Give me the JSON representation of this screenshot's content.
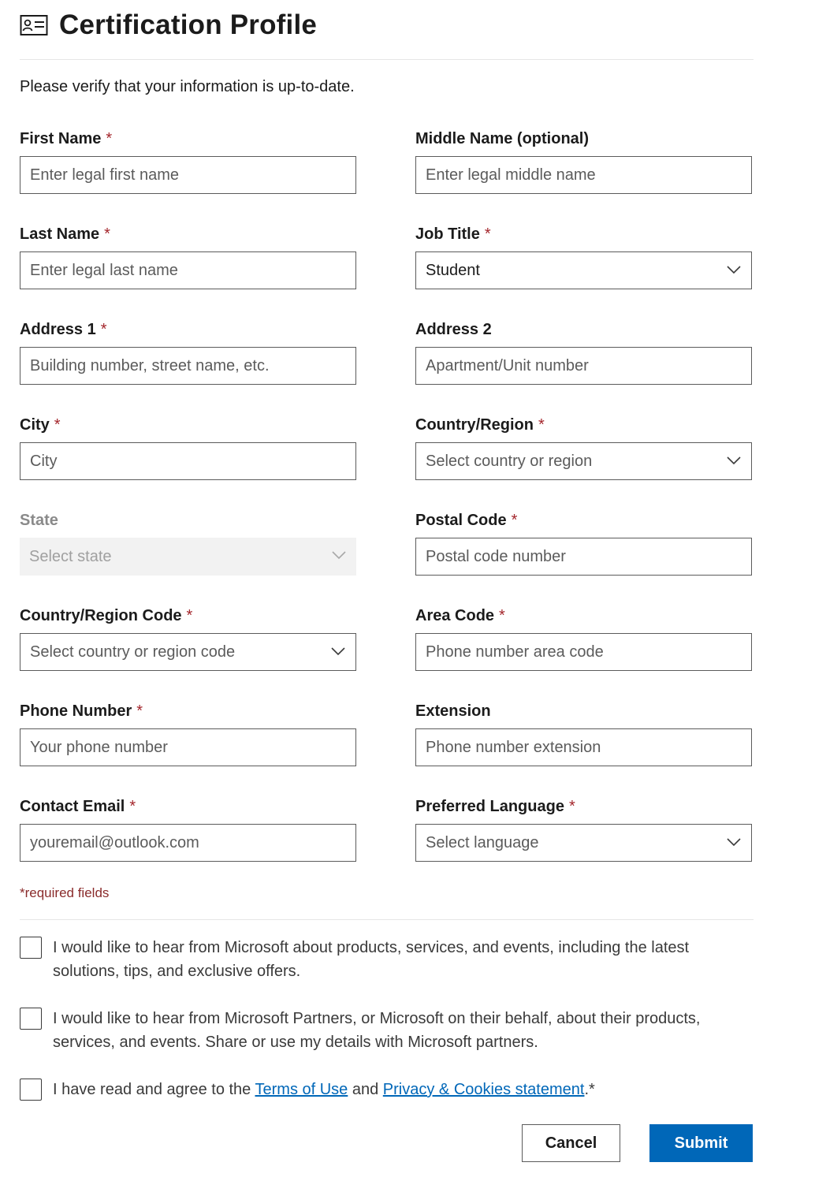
{
  "header": {
    "title": "Certification Profile",
    "icon": "contact-card-icon"
  },
  "intro": "Please verify that your information is up-to-date.",
  "required_marker": "*",
  "fields": {
    "first_name": {
      "label": "First Name",
      "placeholder": "Enter legal first name",
      "required": true
    },
    "middle_name": {
      "label": "Middle Name (optional)",
      "placeholder": "Enter legal middle name",
      "required": false
    },
    "last_name": {
      "label": "Last Name",
      "placeholder": "Enter legal last name",
      "required": true
    },
    "job_title": {
      "label": "Job Title",
      "value": "Student",
      "required": true
    },
    "address1": {
      "label": "Address 1",
      "placeholder": "Building number, street name, etc.",
      "required": true
    },
    "address2": {
      "label": "Address 2",
      "placeholder": "Apartment/Unit number",
      "required": false
    },
    "city": {
      "label": "City",
      "placeholder": "City",
      "required": true
    },
    "country": {
      "label": "Country/Region",
      "placeholder": "Select country or region",
      "required": true
    },
    "state": {
      "label": "State",
      "placeholder": "Select state",
      "disabled": true
    },
    "postal": {
      "label": "Postal Code",
      "placeholder": "Postal code number",
      "required": true
    },
    "country_code": {
      "label": "Country/Region Code",
      "placeholder": "Select country or region code",
      "required": true
    },
    "area_code": {
      "label": "Area Code",
      "placeholder": "Phone number area code",
      "required": true
    },
    "phone": {
      "label": "Phone Number",
      "placeholder": "Your phone number",
      "required": true
    },
    "extension": {
      "label": "Extension",
      "placeholder": "Phone number extension",
      "required": false
    },
    "email": {
      "label": "Contact Email",
      "placeholder": "youremail@outlook.com",
      "required": true
    },
    "language": {
      "label": "Preferred Language",
      "placeholder": "Select language",
      "required": true
    }
  },
  "required_note": "*required fields",
  "consents": {
    "microsoft": "I would like to hear from Microsoft about products, services, and events, including the latest solutions, tips, and exclusive offers.",
    "partners": "I would like to hear from Microsoft Partners, or Microsoft on their behalf, about their products, services, and events. Share or use my details with Microsoft partners.",
    "terms_prefix": "I have read and agree to the ",
    "terms_link": "Terms of Use",
    "terms_and": " and ",
    "privacy_link": "Privacy & Cookies statement",
    "terms_suffix": ".*"
  },
  "buttons": {
    "cancel": "Cancel",
    "submit": "Submit"
  },
  "colors": {
    "accent": "#0067b8",
    "required": "#a4262c",
    "disabled_bg": "#f2f2f2"
  }
}
